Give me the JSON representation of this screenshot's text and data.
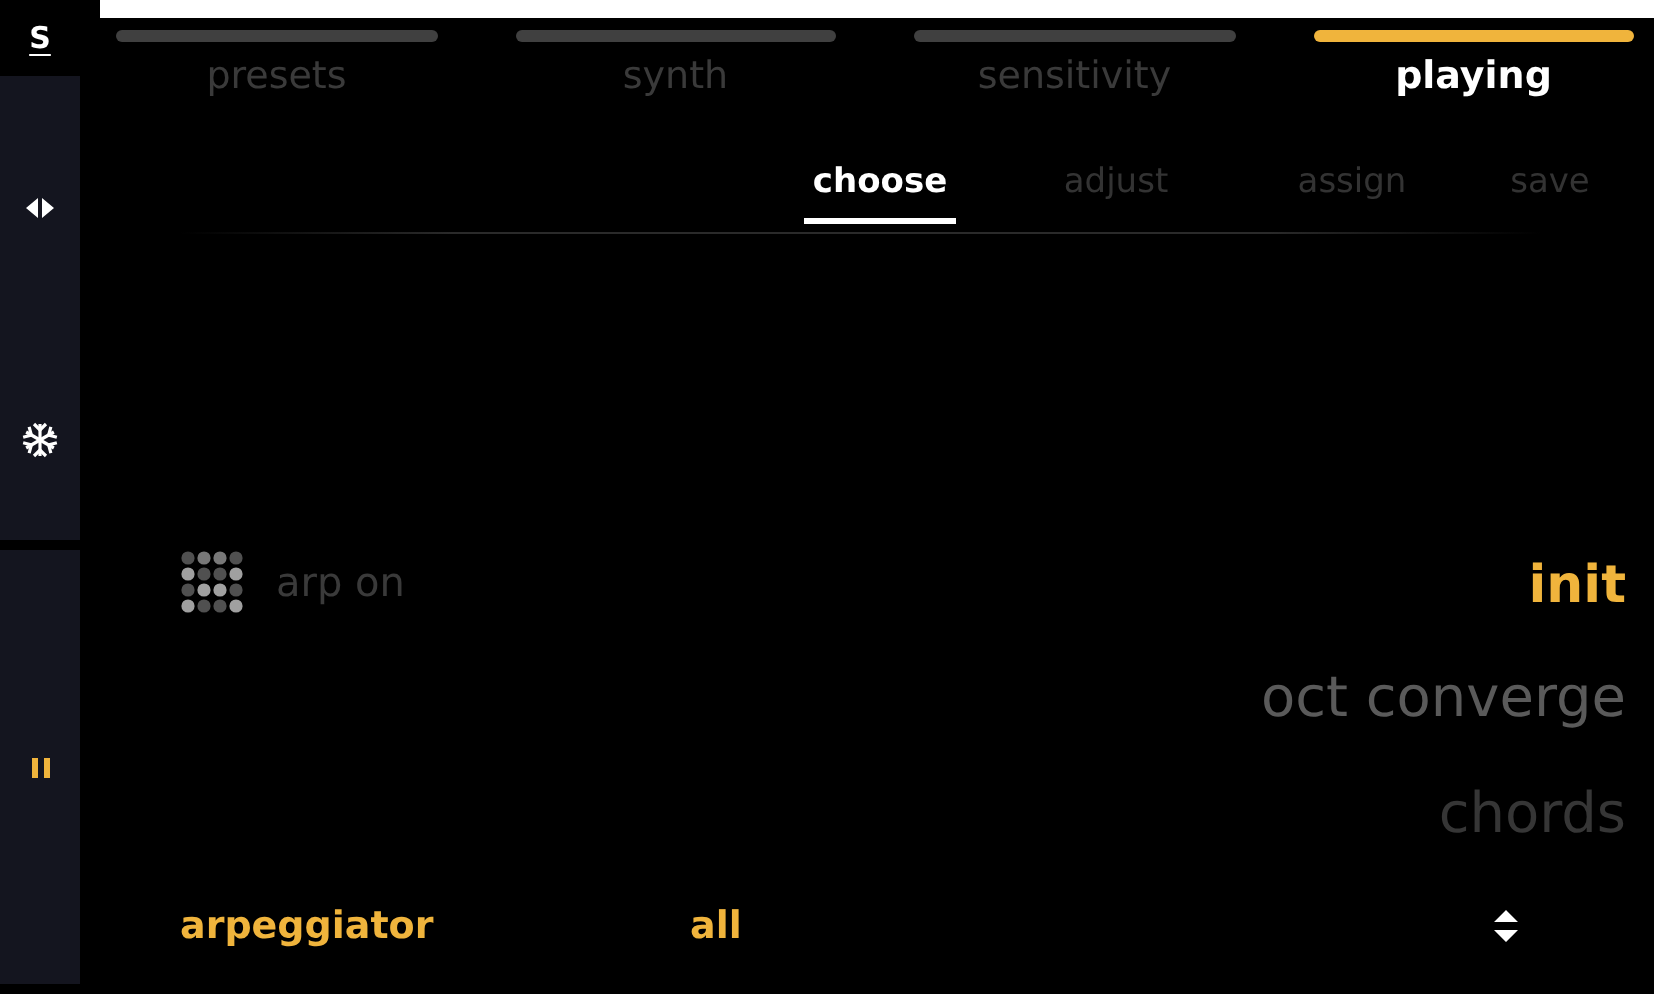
{
  "sidebar": {
    "logo": "S",
    "items": [
      {
        "kind": "arrows",
        "active": false
      },
      {
        "kind": "snowflake",
        "active": false
      },
      {
        "kind": "pause",
        "active": true
      }
    ]
  },
  "tabs": [
    {
      "label": "presets",
      "selected": false
    },
    {
      "label": "synth",
      "selected": false
    },
    {
      "label": "sensitivity",
      "selected": false
    },
    {
      "label": "playing",
      "selected": true
    }
  ],
  "subtabs": [
    {
      "label": "choose",
      "selected": true
    },
    {
      "label": "adjust",
      "selected": false
    },
    {
      "label": "assign",
      "selected": false
    },
    {
      "label": "save",
      "selected": false
    }
  ],
  "arp_toggle": {
    "label": "arp on"
  },
  "presets": [
    {
      "label": "init",
      "selected": true
    },
    {
      "label": "oct converge",
      "selected": false
    },
    {
      "label": "chords",
      "selected": false
    }
  ],
  "footer": {
    "mode": "arpeggiator",
    "filter": "all"
  }
}
